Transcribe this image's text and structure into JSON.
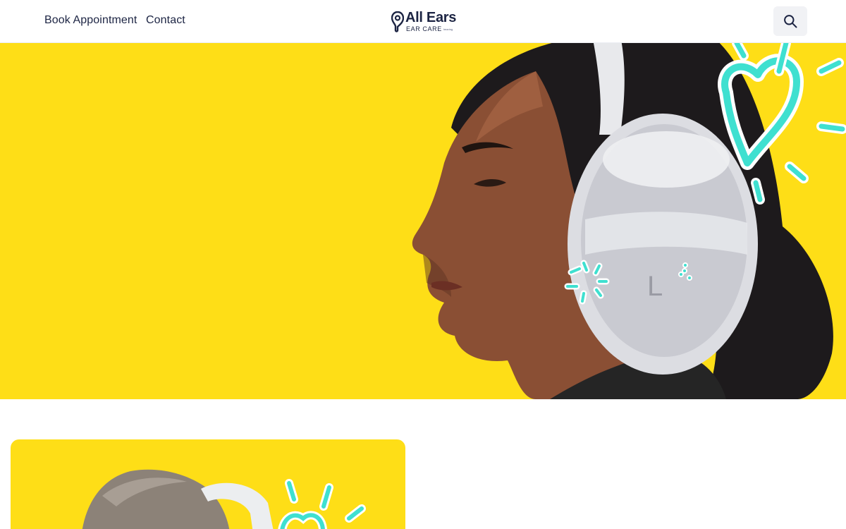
{
  "header": {
    "nav": [
      {
        "label": "Book Appointment"
      },
      {
        "label": "Contact"
      }
    ],
    "logo": {
      "name": "All Ears",
      "tagline": "EAR CARE",
      "tiny_text": "hearing"
    },
    "search_icon": "search-icon"
  },
  "colors": {
    "brand_yellow": "#fede17",
    "navy": "#1c2443",
    "accent_teal": "#3fe0d0"
  }
}
